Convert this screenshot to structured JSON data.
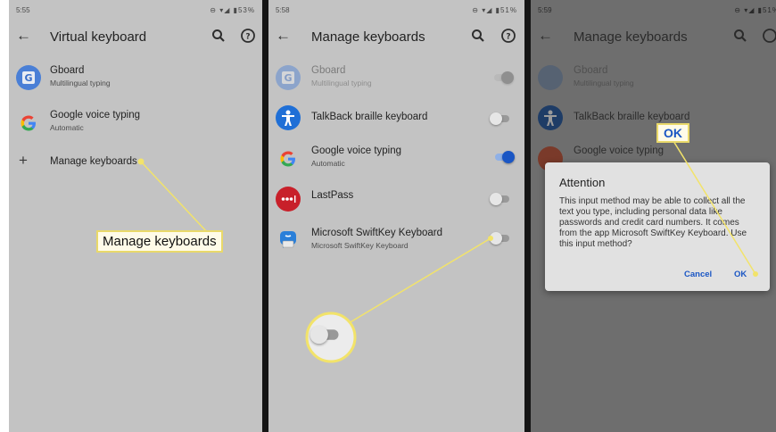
{
  "screens": [
    {
      "status": {
        "time": "5:55",
        "icons": "⊖ ▾◢ ▮53%"
      },
      "title": "Virtual keyboard",
      "items": [
        {
          "name": "Gboard",
          "subtitle": "Multilingual typing"
        },
        {
          "name": "Google voice typing",
          "subtitle": "Automatic"
        },
        {
          "name": "Manage keyboards"
        }
      ]
    },
    {
      "status": {
        "time": "5:58",
        "icons": "⊖ ▾◢ ▮51%"
      },
      "title": "Manage keyboards",
      "items": [
        {
          "name": "Gboard",
          "subtitle": "Multilingual typing",
          "enabled": true,
          "disabled_row": true
        },
        {
          "name": "TalkBack braille keyboard",
          "enabled": false
        },
        {
          "name": "Google voice typing",
          "subtitle": "Automatic",
          "enabled": true
        },
        {
          "name": "LastPass",
          "enabled": false
        },
        {
          "name": "Microsoft SwiftKey Keyboard",
          "subtitle": "Microsoft SwiftKey Keyboard",
          "enabled": false
        }
      ]
    },
    {
      "status": {
        "time": "5:59",
        "icons": "⊖ ▾◢ ▮51%"
      },
      "title": "Manage keyboards",
      "items": [
        {
          "name": "Gboard",
          "subtitle": "Multilingual typing"
        },
        {
          "name": "TalkBack braille keyboard"
        },
        {
          "name": "Google voice typing"
        }
      ],
      "dialog": {
        "title": "Attention",
        "body": "This input method may be able to collect all the text you type, including personal data like passwords and credit card numbers. It comes from the app Microsoft SwiftKey Keyboard. Use this input method?",
        "cancel": "Cancel",
        "ok": "OK"
      }
    }
  ],
  "callouts": {
    "manage_keyboards": "Manage keyboards",
    "ok": "OK"
  },
  "icons": {
    "back": "arrow-back-icon",
    "search": "search-icon",
    "help": "help-icon",
    "gboard": "gboard-icon",
    "google": "google-g-icon",
    "talkback": "accessibility-icon",
    "lastpass": "lastpass-icon",
    "swiftkey": "swiftkey-icon",
    "plus": "plus-icon"
  },
  "colors": {
    "highlight": "#f2e36a",
    "toggle_on": "#1a56c4",
    "dim_overlay": "#6e6e6e"
  }
}
